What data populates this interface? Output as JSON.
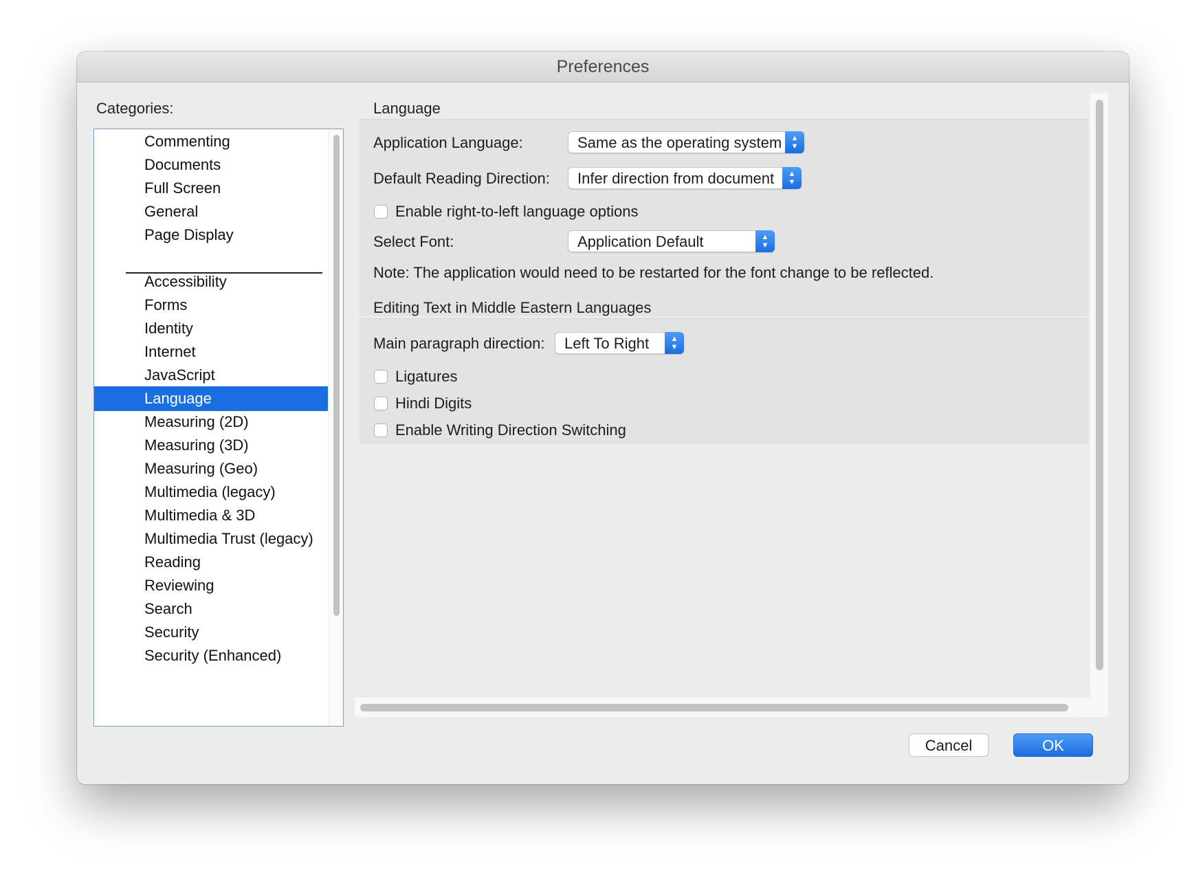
{
  "window": {
    "title": "Preferences"
  },
  "sidebar": {
    "label": "Categories:",
    "selected": "Language",
    "group1": [
      "Commenting",
      "Documents",
      "Full Screen",
      "General",
      "Page Display"
    ],
    "group2": [
      "Accessibility",
      "Forms",
      "Identity",
      "Internet",
      "JavaScript",
      "Language",
      "Measuring (2D)",
      "Measuring (3D)",
      "Measuring (Geo)",
      "Multimedia (legacy)",
      "Multimedia & 3D",
      "Multimedia Trust (legacy)",
      "Reading",
      "Reviewing",
      "Search",
      "Security",
      "Security (Enhanced)"
    ]
  },
  "language_section": {
    "title": "Language",
    "app_language_label": "Application Language:",
    "app_language_value": "Same as the operating system",
    "reading_direction_label": "Default Reading Direction:",
    "reading_direction_value": "Infer direction from document",
    "rtl_label": "Enable right-to-left language options",
    "rtl_checked": false,
    "font_label": "Select Font:",
    "font_value": "Application Default",
    "note": "Note: The application would need to be restarted for the font change to be reflected."
  },
  "middle_east_section": {
    "title": "Editing Text in Middle Eastern Languages",
    "paragraph_label": "Main paragraph direction:",
    "paragraph_value": "Left To Right",
    "ligatures_label": "Ligatures",
    "ligatures_checked": false,
    "hindi_label": "Hindi Digits",
    "hindi_checked": false,
    "writing_dir_label": "Enable Writing Direction Switching",
    "writing_dir_checked": false
  },
  "buttons": {
    "cancel": "Cancel",
    "ok": "OK"
  },
  "colors": {
    "accent": "#1a6ee0",
    "window_bg": "#ececec"
  }
}
